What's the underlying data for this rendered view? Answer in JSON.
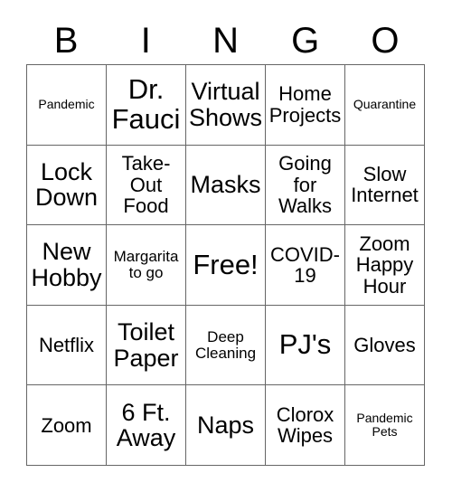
{
  "card": {
    "title": "BINGO",
    "header_letters": [
      "B",
      "I",
      "N",
      "G",
      "O"
    ],
    "grid_size": "5x5",
    "free_space_index": 12,
    "colors": {
      "text": "#000000",
      "background": "#ffffff",
      "grid_line": "#666666"
    },
    "rows": [
      {
        "cells": [
          {
            "text": "Pandemic",
            "size": "xs"
          },
          {
            "text": "Dr.\nFauci",
            "size": "xl"
          },
          {
            "text": "Virtual\nShows",
            "size": "lg"
          },
          {
            "text": "Home\nProjects",
            "size": "md"
          },
          {
            "text": "Quarantine",
            "size": "xs"
          }
        ]
      },
      {
        "cells": [
          {
            "text": "Lock\nDown",
            "size": "lg"
          },
          {
            "text": "Take-\nOut\nFood",
            "size": "md"
          },
          {
            "text": "Masks",
            "size": "lg"
          },
          {
            "text": "Going\nfor\nWalks",
            "size": "md"
          },
          {
            "text": "Slow\nInternet",
            "size": "md"
          }
        ]
      },
      {
        "cells": [
          {
            "text": "New\nHobby",
            "size": "lg"
          },
          {
            "text": "Margarita\nto go",
            "size": "sm"
          },
          {
            "text": "Free!",
            "size": "xl"
          },
          {
            "text": "COVID-\n19",
            "size": "md"
          },
          {
            "text": "Zoom\nHappy\nHour",
            "size": "md"
          }
        ]
      },
      {
        "cells": [
          {
            "text": "Netflix",
            "size": "md"
          },
          {
            "text": "Toilet\nPaper",
            "size": "lg"
          },
          {
            "text": "Deep\nCleaning",
            "size": "sm"
          },
          {
            "text": "PJ's",
            "size": "xl"
          },
          {
            "text": "Gloves",
            "size": "md"
          }
        ]
      },
      {
        "cells": [
          {
            "text": "Zoom",
            "size": "md"
          },
          {
            "text": "6 Ft.\nAway",
            "size": "lg"
          },
          {
            "text": "Naps",
            "size": "lg"
          },
          {
            "text": "Clorox\nWipes",
            "size": "md"
          },
          {
            "text": "Pandemic\nPets",
            "size": "xs"
          }
        ]
      }
    ]
  }
}
